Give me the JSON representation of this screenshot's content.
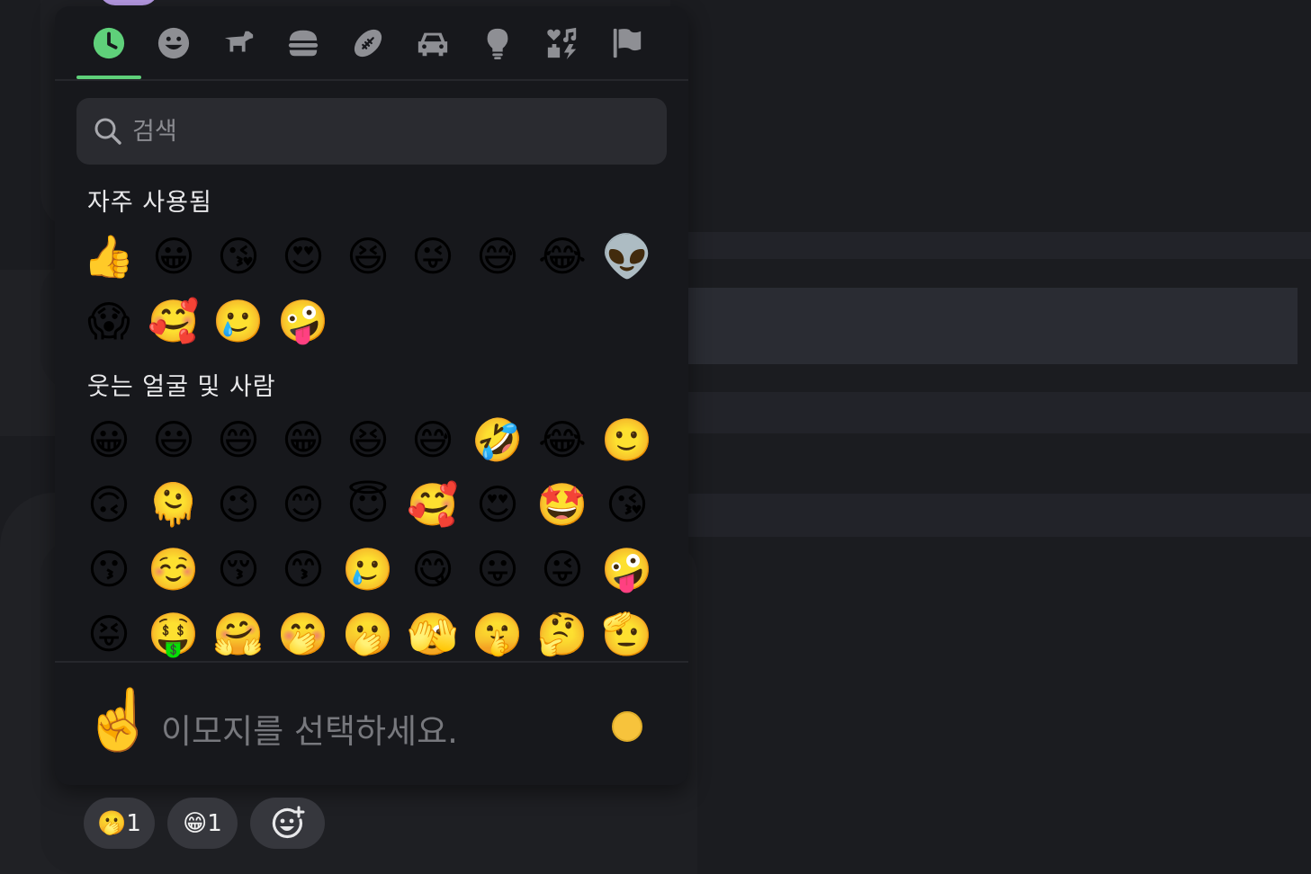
{
  "picker": {
    "tabs": [
      {
        "name": "recent",
        "icon": "clock-icon",
        "active": true
      },
      {
        "name": "smileys",
        "icon": "smiley-icon"
      },
      {
        "name": "animals",
        "icon": "dog-icon"
      },
      {
        "name": "food",
        "icon": "burger-icon"
      },
      {
        "name": "activity",
        "icon": "football-icon"
      },
      {
        "name": "travel",
        "icon": "car-icon"
      },
      {
        "name": "objects",
        "icon": "lightbulb-icon"
      },
      {
        "name": "symbols",
        "icon": "symbols-icon"
      },
      {
        "name": "flags",
        "icon": "flag-icon"
      }
    ],
    "active_color": "#5fd07a",
    "search": {
      "placeholder": "검색",
      "value": ""
    },
    "sections": [
      {
        "title": "자주 사용됨",
        "emojis": [
          "👍",
          "😀",
          "😘",
          "😍",
          "😆",
          "😜",
          "😅",
          "😂",
          "👽",
          "😱",
          "🥰",
          "🥲",
          "🤪"
        ]
      },
      {
        "title": "웃는 얼굴 및 사람",
        "emojis": [
          "😀",
          "😃",
          "😄",
          "😁",
          "😆",
          "😅",
          "🤣",
          "😂",
          "🙂",
          "🙃",
          "🫠",
          "😉",
          "😊",
          "😇",
          "🥰",
          "😍",
          "🤩",
          "😘",
          "😗",
          "☺️",
          "😚",
          "😙",
          "🥲",
          "😋",
          "😛",
          "😜",
          "🤪",
          "😝",
          "🤑",
          "🤗",
          "🤭",
          "🫢",
          "🫣",
          "🤫",
          "🤔",
          "🫡"
        ]
      }
    ],
    "footer": {
      "preview_emoji": "☝️",
      "hint": "이모지를 선택하세요.",
      "skin_tone_color": "#f7c33c"
    }
  },
  "reactions": [
    {
      "emoji": "🫢",
      "count": "1"
    },
    {
      "emoji": "😁",
      "count": "1"
    },
    {
      "icon": "add-reaction-icon"
    }
  ]
}
